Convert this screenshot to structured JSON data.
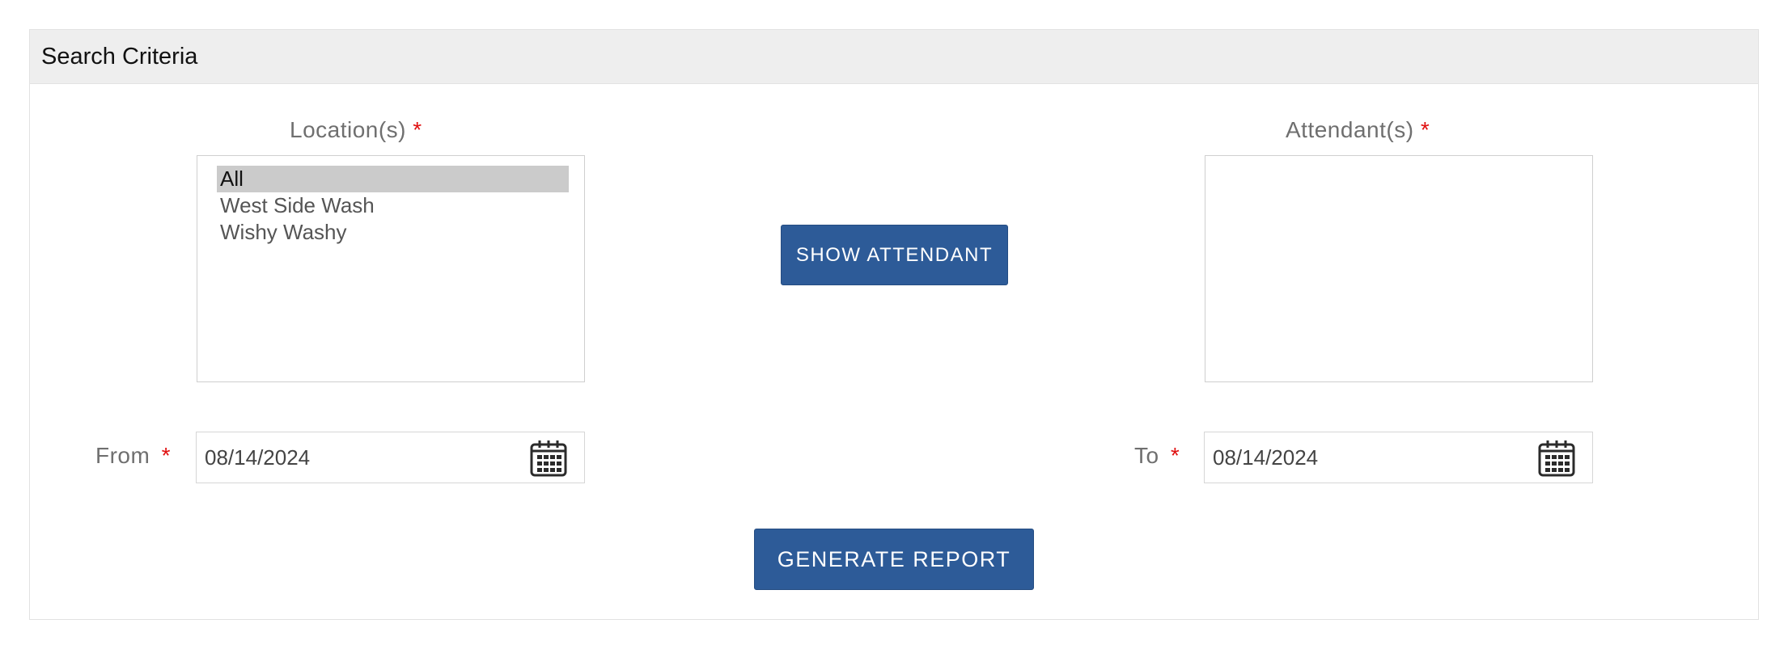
{
  "panel": {
    "title": "Search Criteria"
  },
  "locations": {
    "label": "Location(s)",
    "required_mark": "*",
    "options": [
      "All",
      "West Side Wash",
      "Wishy Washy"
    ],
    "selected": "All"
  },
  "attendants": {
    "label": "Attendant(s)",
    "required_mark": "*",
    "options": []
  },
  "show_attendant_button": {
    "label": "SHOW ATTENDANT"
  },
  "from": {
    "label": "From",
    "required_mark": "*",
    "value": "08/14/2024",
    "icon": "calendar-icon"
  },
  "to": {
    "label": "To",
    "required_mark": "*",
    "value": "08/14/2024",
    "icon": "calendar-icon"
  },
  "generate_report_button": {
    "label": "GENERATE REPORT"
  },
  "colors": {
    "button_bg": "#2d5b98",
    "required": "#e01010",
    "header_bg": "#eeeeee",
    "selected_option_bg": "#cbcbcb"
  }
}
